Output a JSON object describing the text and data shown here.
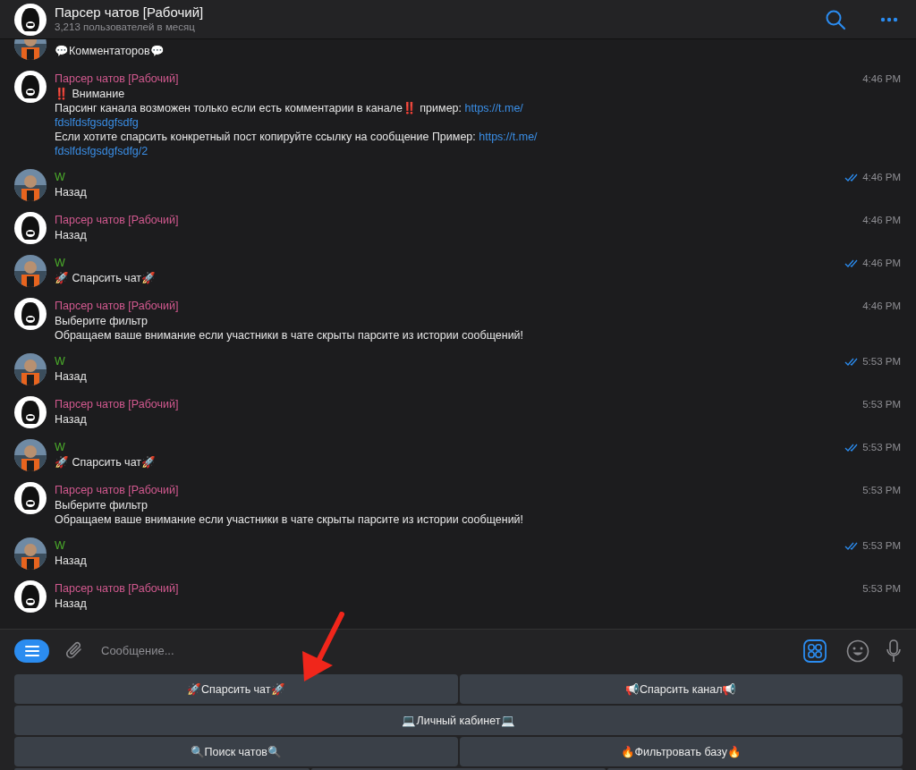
{
  "header": {
    "title": "Парсер чатов [Рабочий]",
    "subtitle": "3,213 пользователей в месяц"
  },
  "messages": [
    {
      "kind": "user",
      "lines": [
        [
          {
            "text": "💬Комментаторов💬",
            "link": false
          }
        ]
      ]
    },
    {
      "kind": "bot",
      "name": "Парсер чатов [Рабочий]",
      "time": "4:46 PM",
      "lines": [
        [
          {
            "text": "‼️ Внимание",
            "link": false
          }
        ],
        [
          {
            "text": "Парсинг канала возможен только если есть комментарии в канале‼️ пример: ",
            "link": false
          },
          {
            "text": "https://t.me/",
            "link": true
          }
        ],
        [
          {
            "text": "fdslfdsfgsdgfsdfg",
            "link": true
          }
        ],
        [
          {
            "text": "Если хотите спарсить конкретный пост копируйте ссылку на сообщение Пример: ",
            "link": false
          },
          {
            "text": "https://t.me/",
            "link": true
          }
        ],
        [
          {
            "text": "fdslfdsfgsdgfsdfg/2",
            "link": true
          }
        ]
      ]
    },
    {
      "kind": "user",
      "name": "W",
      "time": "4:46 PM",
      "read": true,
      "lines": [
        [
          {
            "text": "Назад",
            "link": false
          }
        ]
      ]
    },
    {
      "kind": "bot",
      "name": "Парсер чатов [Рабочий]",
      "time": "4:46 PM",
      "lines": [
        [
          {
            "text": "Назад",
            "link": false
          }
        ]
      ]
    },
    {
      "kind": "user",
      "name": "W",
      "time": "4:46 PM",
      "read": true,
      "lines": [
        [
          {
            "text": "🚀 Спарсить чат🚀",
            "link": false
          }
        ]
      ]
    },
    {
      "kind": "bot",
      "name": "Парсер чатов [Рабочий]",
      "time": "4:46 PM",
      "lines": [
        [
          {
            "text": "Выберите фильтр",
            "link": false
          }
        ],
        [
          {
            "text": "Обращаем ваше внимание если участники в чате скрыты парсите из истории сообщений!",
            "link": false
          }
        ]
      ]
    },
    {
      "kind": "user",
      "name": "W",
      "time": "5:53 PM",
      "read": true,
      "lines": [
        [
          {
            "text": "Назад",
            "link": false
          }
        ]
      ]
    },
    {
      "kind": "bot",
      "name": "Парсер чатов [Рабочий]",
      "time": "5:53 PM",
      "lines": [
        [
          {
            "text": "Назад",
            "link": false
          }
        ]
      ]
    },
    {
      "kind": "user",
      "name": "W",
      "time": "5:53 PM",
      "read": true,
      "lines": [
        [
          {
            "text": "🚀 Спарсить чат🚀",
            "link": false
          }
        ]
      ]
    },
    {
      "kind": "bot",
      "name": "Парсер чатов [Рабочий]",
      "time": "5:53 PM",
      "lines": [
        [
          {
            "text": "Выберите фильтр",
            "link": false
          }
        ],
        [
          {
            "text": "Обращаем ваше внимание если участники в чате скрыты парсите из истории сообщений!",
            "link": false
          }
        ]
      ]
    },
    {
      "kind": "user",
      "name": "W",
      "time": "5:53 PM",
      "read": true,
      "lines": [
        [
          {
            "text": "Назад",
            "link": false
          }
        ]
      ]
    },
    {
      "kind": "bot",
      "name": "Парсер чатов [Рабочий]",
      "time": "5:53 PM",
      "lines": [
        [
          {
            "text": "Назад",
            "link": false
          }
        ]
      ]
    }
  ],
  "composer": {
    "placeholder": "Сообщение..."
  },
  "keyboard": [
    [
      "🚀Спарсить чат🚀",
      "📢Спарсить канал📢"
    ],
    [
      "💻Личный кабинет💻"
    ],
    [
      "🔍Поиск чатов🔍",
      "🔥Фильтровать базу🔥"
    ]
  ]
}
